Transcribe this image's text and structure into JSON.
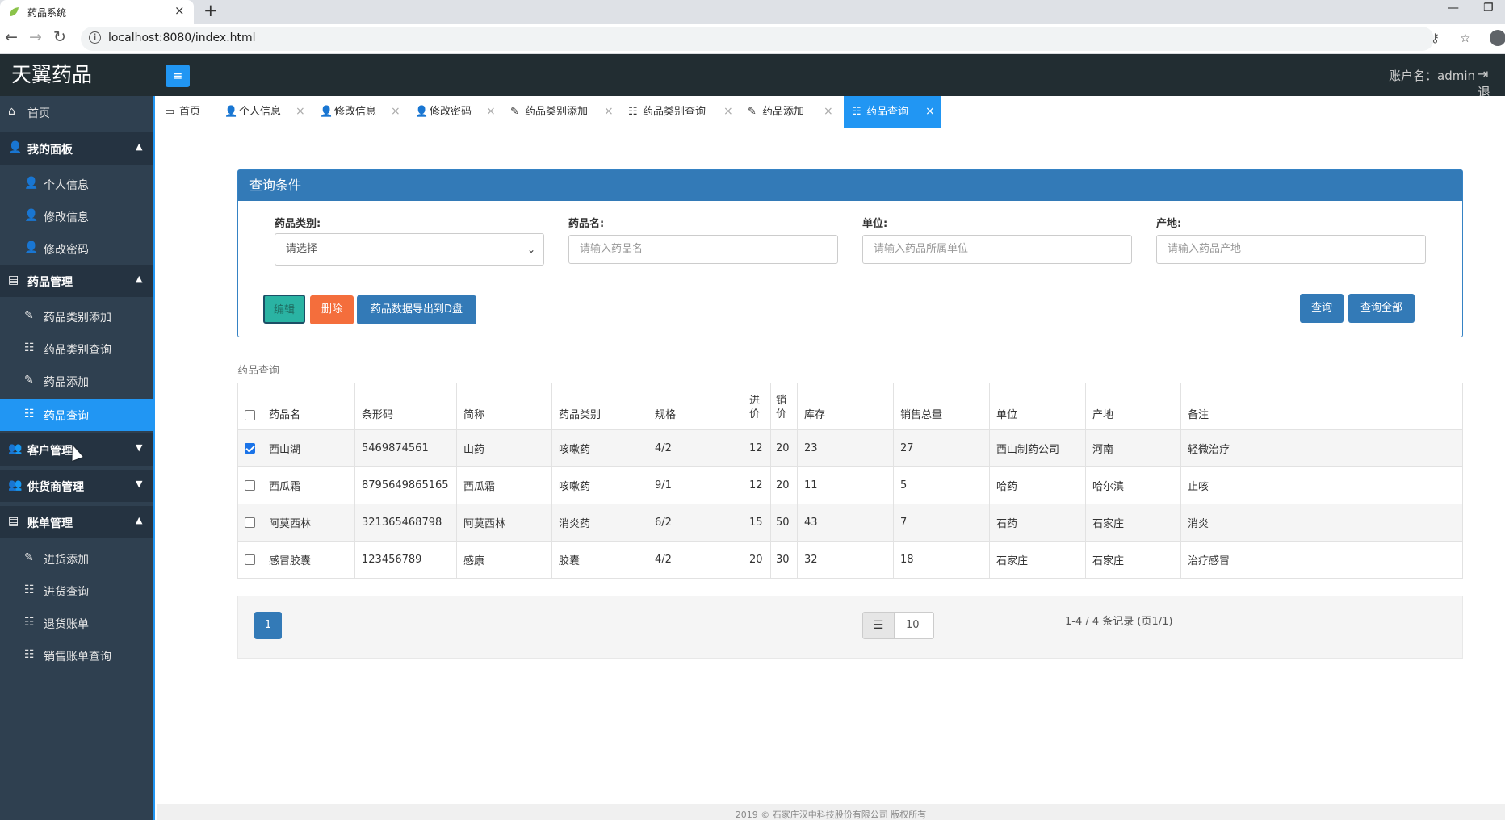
{
  "browser": {
    "tab_title": "药品系统",
    "url": "localhost:8080/index.html"
  },
  "header": {
    "logo": "天翼药品",
    "account": "账户名：admin",
    "logout_fragment": "退"
  },
  "sidebar": {
    "items": [
      {
        "label": "首页",
        "icon": "home-icon",
        "kind": "item"
      },
      {
        "label": "我的面板",
        "icon": "user-icon",
        "kind": "group",
        "arrow": "up"
      },
      {
        "label": "个人信息",
        "icon": "user-icon",
        "kind": "sub"
      },
      {
        "label": "修改信息",
        "icon": "user-icon",
        "kind": "sub"
      },
      {
        "label": "修改密码",
        "icon": "user-icon",
        "kind": "sub"
      },
      {
        "label": "药品管理",
        "icon": "document-icon",
        "kind": "group",
        "arrow": "up"
      },
      {
        "label": "药品类别添加",
        "icon": "edit-icon",
        "kind": "sub"
      },
      {
        "label": "药品类别查询",
        "icon": "list-icon",
        "kind": "sub"
      },
      {
        "label": "药品添加",
        "icon": "edit-icon",
        "kind": "sub"
      },
      {
        "label": "药品查询",
        "icon": "list-icon",
        "kind": "sub",
        "active": true
      },
      {
        "label": "客户管理",
        "icon": "users-icon",
        "kind": "group",
        "arrow": "down"
      },
      {
        "label": "供货商管理",
        "icon": "users-icon",
        "kind": "group",
        "arrow": "down"
      },
      {
        "label": "账单管理",
        "icon": "document-icon",
        "kind": "group",
        "arrow": "up"
      },
      {
        "label": "进货添加",
        "icon": "edit-icon",
        "kind": "sub"
      },
      {
        "label": "进货查询",
        "icon": "list-icon",
        "kind": "sub"
      },
      {
        "label": "退货账单",
        "icon": "list-icon",
        "kind": "sub"
      },
      {
        "label": "销售账单查询",
        "icon": "list-icon",
        "kind": "sub"
      }
    ]
  },
  "tabs": [
    {
      "label": "首页",
      "icon": "monitor-icon",
      "closable": false
    },
    {
      "label": "个人信息",
      "icon": "user-icon",
      "closable": true
    },
    {
      "label": "修改信息",
      "icon": "user-icon",
      "closable": true
    },
    {
      "label": "修改密码",
      "icon": "user-key-icon",
      "closable": true
    },
    {
      "label": "药品类别添加",
      "icon": "edit-icon",
      "closable": true
    },
    {
      "label": "药品类别查询",
      "icon": "list-icon",
      "closable": true
    },
    {
      "label": "药品添加",
      "icon": "edit-icon",
      "closable": true
    },
    {
      "label": "药品查询",
      "icon": "list-icon",
      "closable": true,
      "active": true
    }
  ],
  "query": {
    "title": "查询条件",
    "fields": {
      "category": {
        "label": "药品类别:",
        "value": "请选择"
      },
      "name": {
        "label": "药品名:",
        "placeholder": "请输入药品名"
      },
      "unit": {
        "label": "单位:",
        "placeholder": "请输入药品所属单位"
      },
      "origin": {
        "label": "产地:",
        "placeholder": "请输入药品产地"
      }
    },
    "buttons": {
      "edit": "编辑",
      "delete": "删除",
      "export": "药品数据导出到D盘",
      "search": "查询",
      "search_all": "查询全部"
    }
  },
  "table": {
    "caption": "药品查询",
    "headers": [
      "药品名",
      "条形码",
      "简称",
      "药品类别",
      "规格",
      "进价",
      "销价",
      "库存",
      "销售总量",
      "单位",
      "产地",
      "备注"
    ],
    "rows": [
      {
        "checked": true,
        "cells": [
          "西山湖",
          "5469874561",
          "山药",
          "咳嗽药",
          "4/2",
          "12",
          "20",
          "23",
          "27",
          "西山制药公司",
          "河南",
          "轻微治疗"
        ]
      },
      {
        "checked": false,
        "cells": [
          "西瓜霜",
          "8795649865165",
          "西瓜霜",
          "咳嗽药",
          "9/1",
          "12",
          "20",
          "11",
          "5",
          "哈药",
          "哈尔滨",
          "止咳"
        ]
      },
      {
        "checked": false,
        "cells": [
          "阿莫西林",
          "321365468798",
          "阿莫西林",
          "消炎药",
          "6/2",
          "15",
          "50",
          "43",
          "7",
          "石药",
          "石家庄",
          "消炎"
        ]
      },
      {
        "checked": false,
        "cells": [
          "感冒胶囊",
          "123456789",
          "感康",
          "胶囊",
          "4/2",
          "20",
          "30",
          "32",
          "18",
          "石家庄",
          "石家庄",
          "治疗感冒"
        ]
      }
    ]
  },
  "pager": {
    "current_page": "1",
    "page_size": "10",
    "info": "1-4 / 4 条记录 (页1/1)"
  },
  "footer": {
    "text": "2019 © 石家庄汉中科技股份有限公司 版权所有"
  },
  "colors": {
    "accent": "#2196f3",
    "header_bg": "#222d32",
    "sidebar_bg": "#2f4050",
    "panel_blue": "#337ab7",
    "delete_orange": "#f46e3c",
    "edit_teal": "#2ab3a3"
  }
}
